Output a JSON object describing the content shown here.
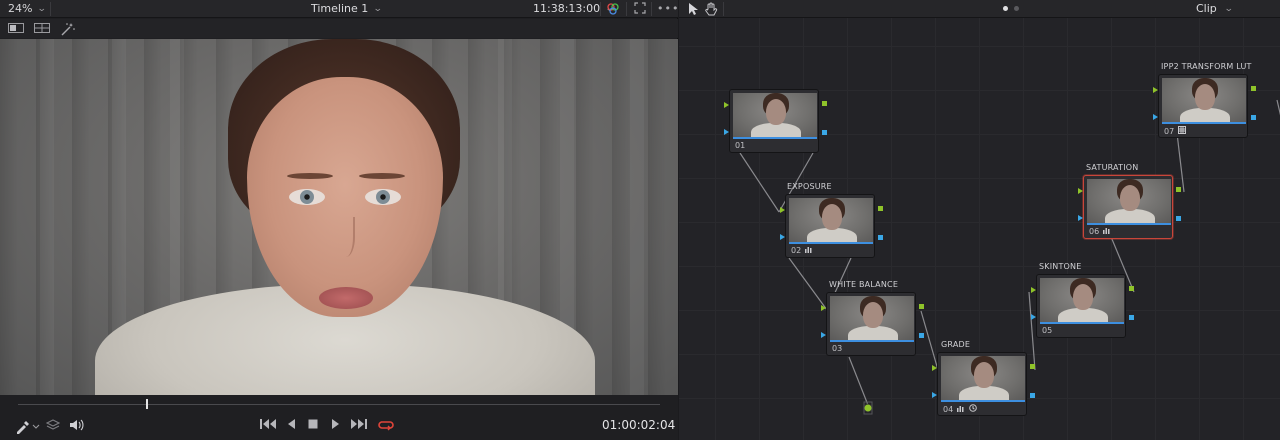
{
  "viewer": {
    "zoom": "24%",
    "timeline_title": "Timeline 1",
    "timecode_top": "11:38:13:00",
    "timecode_bottom": "01:00:02:04",
    "playhead_fraction": 0.2
  },
  "node_editor": {
    "clip_label": "Clip",
    "page_indicator": {
      "pages": 2,
      "active": 1
    }
  },
  "nodes": [
    {
      "id": "01",
      "title": ""
    },
    {
      "id": "02",
      "title": "EXPOSURE",
      "icon": "histogram-icon"
    },
    {
      "id": "03",
      "title": "WHITE BALANCE"
    },
    {
      "id": "04",
      "title": "GRADE",
      "icon": "histogram-icon",
      "icon2": "clock-icon"
    },
    {
      "id": "05",
      "title": "SKINTONE"
    },
    {
      "id": "06",
      "title": "SATURATION",
      "icon": "histogram-icon",
      "selected": true
    },
    {
      "id": "07",
      "title": "IPP2 TRANSFORM LUT",
      "icon": "lut-grid-icon"
    }
  ],
  "colors": {
    "accent_blue": "#3d8fe0",
    "port_green": "#8fc32a",
    "port_blue": "#3aa7e6",
    "selected_border": "#c9463a",
    "loop_red": "#e0453a"
  }
}
